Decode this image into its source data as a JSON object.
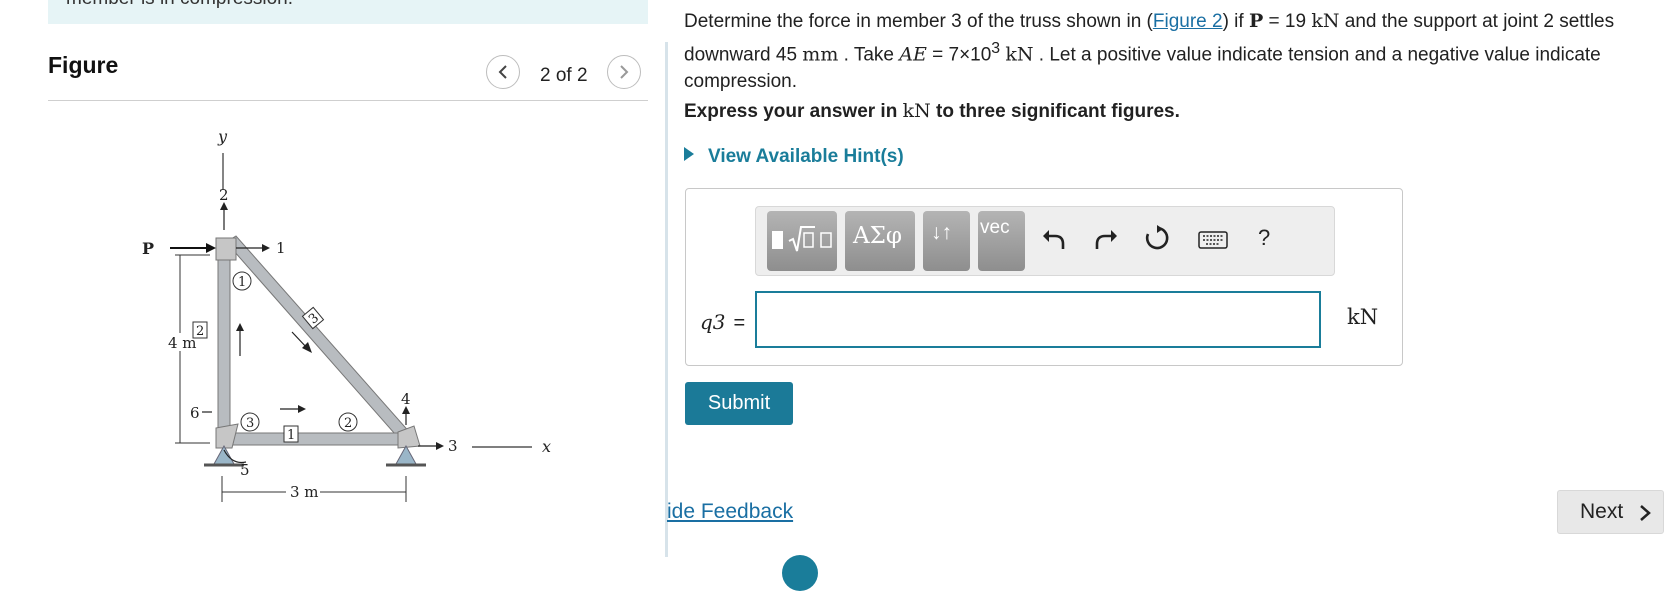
{
  "header": {
    "cut_text": "member is in compression."
  },
  "figure": {
    "title": "Figure",
    "page_indicator": "2 of 2",
    "labels": {
      "y": "y",
      "x": "x",
      "P": "P",
      "n1": "1",
      "n2": "2",
      "n3": "3",
      "n4": "4",
      "n5": "5",
      "n6": "6",
      "m1": "1",
      "m2": "2",
      "m3": "3",
      "e1": "1",
      "e2": "2",
      "e3": "3",
      "h": "4 m",
      "w": "3 m"
    }
  },
  "problem": {
    "t1": "Determine the force in member 3 of the truss shown in (",
    "link": "Figure 2",
    "t2": ") if ",
    "P": "P",
    "eq1": " = 19 ",
    "kN1": "kN",
    "t3": " and the support at joint 2 settles downward 45 ",
    "mm": "mm",
    "t4": " . Take ",
    "AE": "AE",
    "eq2": " = 7×10",
    "exp": "3",
    "kN2": "kN",
    "t5": " . Let a positive value indicate tension and a negative value indicate compression."
  },
  "instruction": {
    "pre": "Express your answer in ",
    "unit": "kN",
    "post": " to three significant figures."
  },
  "hints_label": "View Available Hint(s)",
  "toolbar": {
    "greek": "ΑΣφ",
    "arrows": "↓↑",
    "vec": "vec",
    "help": "?"
  },
  "answer": {
    "variable": "q3",
    "sub": "",
    "equals": "=",
    "value": "",
    "unit": "kN"
  },
  "buttons": {
    "submit": "Submit",
    "feedback": "ide Feedback",
    "next": "Next"
  }
}
